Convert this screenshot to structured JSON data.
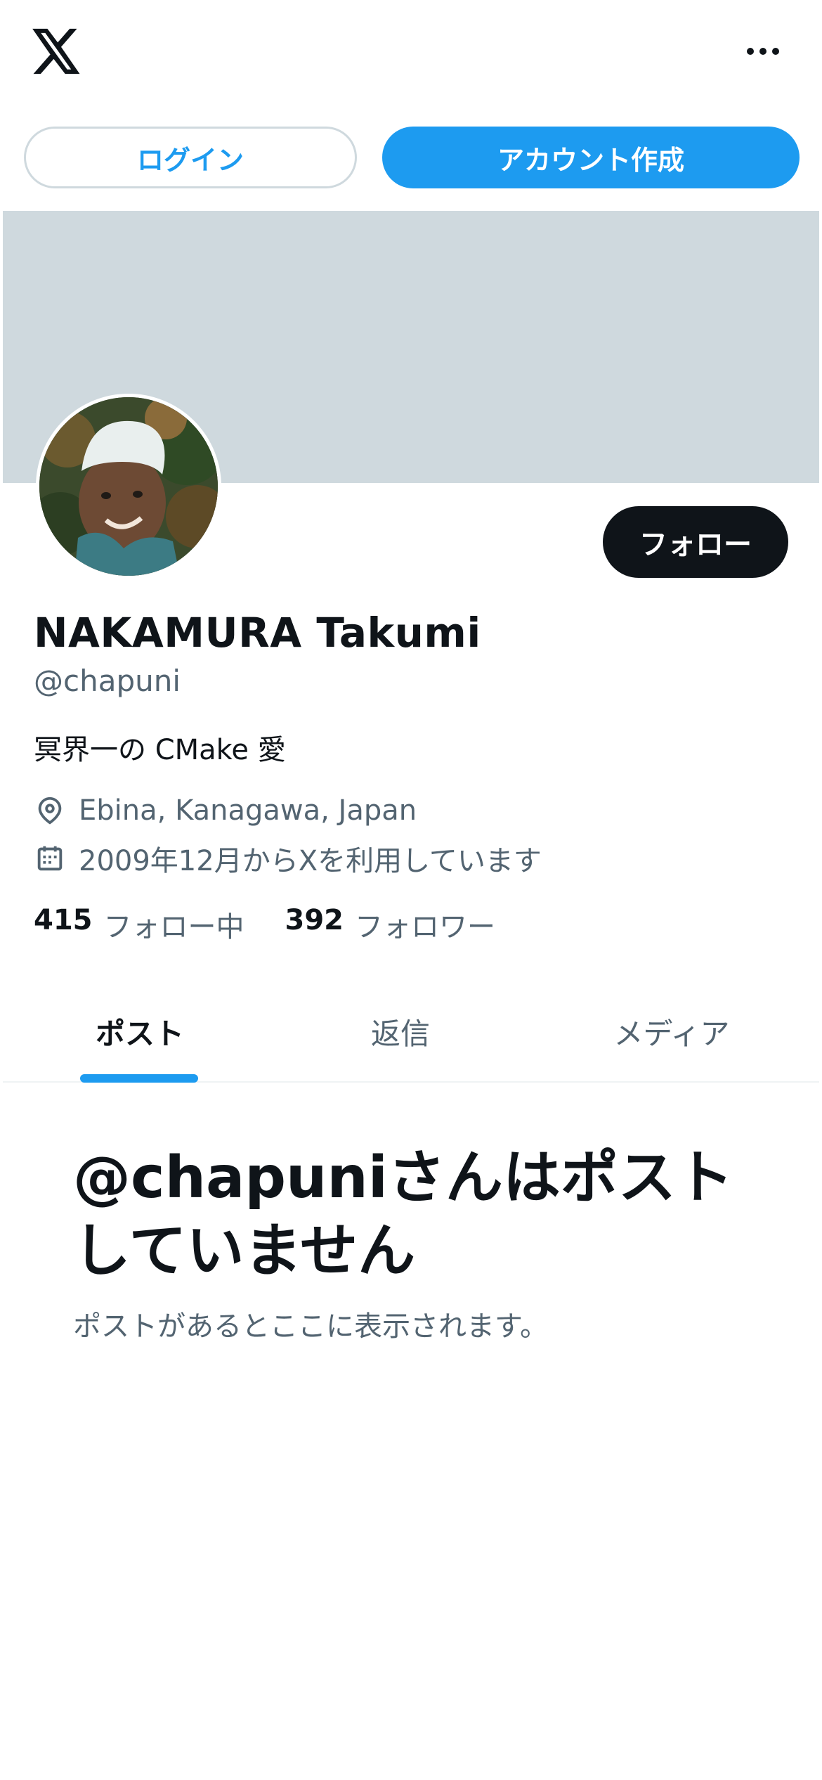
{
  "auth": {
    "login_label": "ログイン",
    "signup_label": "アカウント作成"
  },
  "profile": {
    "follow_label": "フォロー",
    "name": "NAKAMURA Takumi",
    "handle": "@chapuni",
    "bio": "冥界一の CMake 愛",
    "location": "Ebina, Kanagawa, Japan",
    "joined": "2009年12月からXを利用しています",
    "following_count": "415",
    "following_label": "フォロー中",
    "followers_count": "392",
    "followers_label": "フォロワー"
  },
  "tabs": [
    {
      "label": "ポスト",
      "active": true
    },
    {
      "label": "返信",
      "active": false
    },
    {
      "label": "メディア",
      "active": false
    }
  ],
  "empty_state": {
    "title": "@chapuniさんはポストしていません",
    "subtitle": "ポストがあるとここに表示されます。"
  },
  "colors": {
    "accent": "#1d9bf0",
    "text": "#0f1419",
    "secondary_text": "#536471",
    "banner": "#cfd9de"
  },
  "icons": {
    "logo": "x-logo-icon",
    "more": "more-horizontal-icon",
    "location": "location-pin-icon",
    "calendar": "calendar-icon"
  }
}
